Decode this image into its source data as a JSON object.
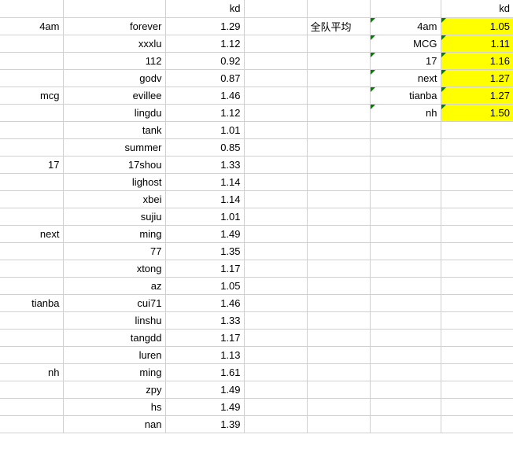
{
  "header": {
    "kd": "kd",
    "team_avg": "全队平均"
  },
  "left": [
    {
      "team": "4am",
      "player": "forever",
      "kd": "1.29"
    },
    {
      "team": "",
      "player": "xxxlu",
      "kd": "1.12"
    },
    {
      "team": "",
      "player": "112",
      "kd": "0.92"
    },
    {
      "team": "",
      "player": "godv",
      "kd": "0.87"
    },
    {
      "team": "mcg",
      "player": "evillee",
      "kd": "1.46"
    },
    {
      "team": "",
      "player": "lingdu",
      "kd": "1.12"
    },
    {
      "team": "",
      "player": "tank",
      "kd": "1.01"
    },
    {
      "team": "",
      "player": "summer",
      "kd": "0.85"
    },
    {
      "team": "17",
      "player": "17shou",
      "kd": "1.33"
    },
    {
      "team": "",
      "player": "lighost",
      "kd": "1.14"
    },
    {
      "team": "",
      "player": "xbei",
      "kd": "1.14"
    },
    {
      "team": "",
      "player": "sujiu",
      "kd": "1.01"
    },
    {
      "team": "next",
      "player": "ming",
      "kd": "1.49"
    },
    {
      "team": "",
      "player": "77",
      "kd": "1.35"
    },
    {
      "team": "",
      "player": "xtong",
      "kd": "1.17"
    },
    {
      "team": "",
      "player": "az",
      "kd": "1.05"
    },
    {
      "team": "tianba",
      "player": "cui71",
      "kd": "1.46"
    },
    {
      "team": "",
      "player": "linshu",
      "kd": "1.33"
    },
    {
      "team": "",
      "player": "tangdd",
      "kd": "1.17"
    },
    {
      "team": "",
      "player": "luren",
      "kd": "1.13"
    },
    {
      "team": "nh",
      "player": "ming",
      "kd": "1.61"
    },
    {
      "team": "",
      "player": "zpy",
      "kd": "1.49"
    },
    {
      "team": "",
      "player": "hs",
      "kd": "1.49"
    },
    {
      "team": "",
      "player": "nan",
      "kd": "1.39"
    }
  ],
  "right": [
    {
      "team": "4am",
      "kd": "1.05"
    },
    {
      "team": "MCG",
      "kd": "1.11"
    },
    {
      "team": "17",
      "kd": "1.16"
    },
    {
      "team": "next",
      "kd": "1.27"
    },
    {
      "team": "tianba",
      "kd": "1.27"
    },
    {
      "team": "nh",
      "kd": "1.50"
    }
  ]
}
